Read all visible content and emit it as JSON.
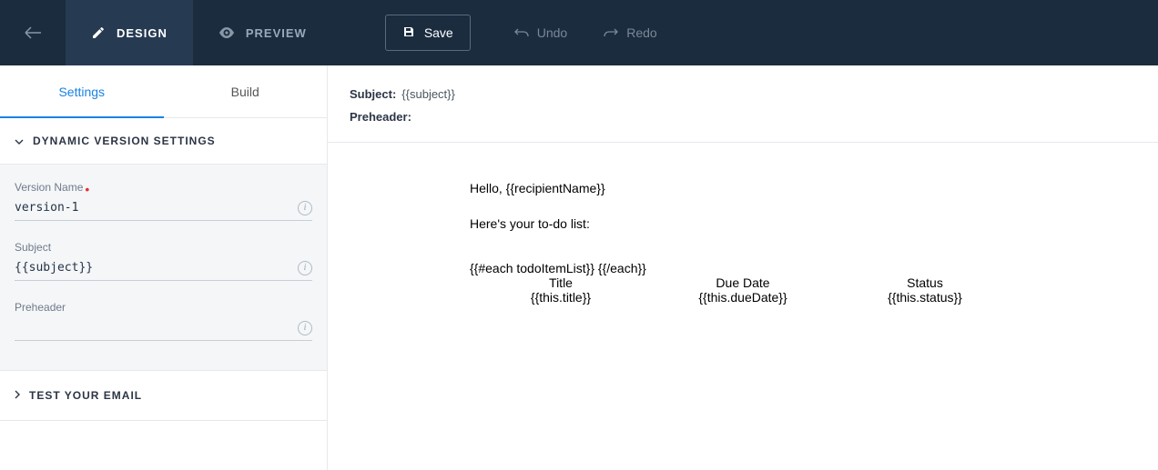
{
  "topbar": {
    "tabs": {
      "design": "Design",
      "preview": "Preview"
    },
    "save": "Save",
    "undo": "Undo",
    "redo": "Redo"
  },
  "sidebar": {
    "tabs": {
      "settings": "Settings",
      "build": "Build"
    },
    "panel_title": "Dynamic Version Settings",
    "fields": {
      "version_name": {
        "label": "Version Name",
        "value": "version-1"
      },
      "subject": {
        "label": "Subject",
        "value": "{{subject}}"
      },
      "preheader": {
        "label": "Preheader",
        "value": ""
      }
    },
    "test_section": "Test Your Email"
  },
  "content": {
    "subject_label": "Subject:",
    "subject_value": "{{subject}}",
    "preheader_label": "Preheader:",
    "preheader_value": "",
    "email": {
      "greeting": "Hello, {{recipientName}}",
      "intro": "Here's your to-do list:",
      "each_open": "{{#each todoItemList}} {{/each}}",
      "headers": {
        "title": "Title",
        "due": "Due Date",
        "status": "Status"
      },
      "row": {
        "title": "{{this.title}}",
        "due": "{{this.dueDate}}",
        "status": "{{this.status}}"
      }
    }
  }
}
